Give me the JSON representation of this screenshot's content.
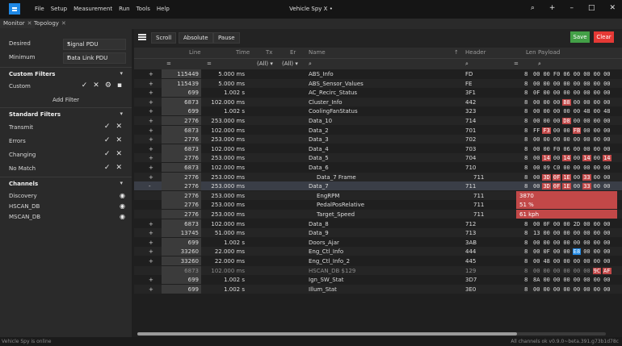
{
  "title": "Vehicle Spy X •",
  "menu": [
    "File",
    "Setup",
    "Measurement",
    "Run",
    "Tools",
    "Help"
  ],
  "window_controls": {
    "search": "⌕",
    "add": "+",
    "minimize": "–",
    "maximize": "□",
    "close": "✕"
  },
  "tabs": [
    {
      "label": "Monitor"
    },
    {
      "label": "Topology"
    }
  ],
  "left": {
    "desired_label": "Desired",
    "desired_value": "Signal PDU",
    "minimum_label": "Minimum",
    "minimum_value": "Data Link PDU",
    "custom_filters_title": "Custom Filters",
    "custom_item": "Custom",
    "add_filter": "Add Filter",
    "standard_filters_title": "Standard Filters",
    "standard_filters": [
      "Transmit",
      "Errors",
      "Changing",
      "No Match"
    ],
    "channels_title": "Channels",
    "channels": [
      "Discovery",
      "HSCAN_DB",
      "MSCAN_DB"
    ]
  },
  "toolbar": {
    "scroll": "Scroll",
    "absolute": "Absolute",
    "pause": "Pause",
    "save": "Save",
    "clear": "Clear"
  },
  "columns": {
    "line": "Line",
    "time": "Time",
    "tx": "Tx",
    "er": "Er",
    "name": "Name",
    "header": "Header",
    "len": "Len",
    "payload": "Payload"
  },
  "filters": {
    "eq": "=",
    "all1": "(All)",
    "all2": "(All)",
    "search": "⌕"
  },
  "rows": [
    {
      "plus": "+",
      "count": "115449",
      "time": "5.000 ms",
      "name": "ABS_Info",
      "header": "FD",
      "len": "8",
      "payload": [
        "00",
        "00",
        "F0",
        "06",
        "00",
        "00",
        "00",
        "00"
      ],
      "hl": []
    },
    {
      "plus": "+",
      "count": "115439",
      "time": "5.000 ms",
      "name": "ABS_Sensor_Values",
      "header": "FE",
      "len": "8",
      "payload": [
        "00",
        "00",
        "00",
        "00",
        "00",
        "00",
        "00",
        "00"
      ],
      "hl": []
    },
    {
      "plus": "+",
      "count": "699",
      "time": "1.002 s",
      "name": "AC_Recirc_Status",
      "header": "3F1",
      "len": "8",
      "payload": [
        "0F",
        "00",
        "00",
        "00",
        "00",
        "00",
        "00",
        "00"
      ],
      "hl": []
    },
    {
      "plus": "+",
      "count": "6873",
      "time": "102.000 ms",
      "name": "Cluster_Info",
      "header": "442",
      "len": "8",
      "payload": [
        "00",
        "00",
        "00",
        "B8",
        "00",
        "00",
        "00",
        "00"
      ],
      "hl": [
        3
      ]
    },
    {
      "plus": "+",
      "count": "699",
      "time": "1.002 s",
      "name": "CoolingFanStatus",
      "header": "323",
      "len": "8",
      "payload": [
        "00",
        "00",
        "00",
        "00",
        "00",
        "48",
        "00",
        "48"
      ],
      "hl": []
    },
    {
      "plus": "+",
      "count": "2776",
      "time": "253.000 ms",
      "name": "Data_10",
      "header": "714",
      "len": "8",
      "payload": [
        "00",
        "00",
        "00",
        "D8",
        "00",
        "00",
        "00",
        "00"
      ],
      "hl": [
        3
      ]
    },
    {
      "plus": "+",
      "count": "6873",
      "time": "102.000 ms",
      "name": "Data_2",
      "header": "701",
      "len": "8",
      "payload": [
        "FF",
        "F3",
        "00",
        "00",
        "FB",
        "00",
        "00",
        "00"
      ],
      "hl": [
        1,
        4
      ]
    },
    {
      "plus": "+",
      "count": "2776",
      "time": "253.000 ms",
      "name": "Data_3",
      "header": "702",
      "len": "8",
      "payload": [
        "00",
        "00",
        "00",
        "00",
        "00",
        "00",
        "00",
        "00"
      ],
      "hl": []
    },
    {
      "plus": "+",
      "count": "6873",
      "time": "102.000 ms",
      "name": "Data_4",
      "header": "703",
      "len": "8",
      "payload": [
        "00",
        "00",
        "F0",
        "06",
        "00",
        "00",
        "00",
        "00"
      ],
      "hl": []
    },
    {
      "plus": "+",
      "count": "2776",
      "time": "253.000 ms",
      "name": "Data_5",
      "header": "704",
      "len": "8",
      "payload": [
        "00",
        "14",
        "00",
        "14",
        "00",
        "14",
        "00",
        "14"
      ],
      "hl": [
        1,
        3,
        5,
        7
      ]
    },
    {
      "plus": "+",
      "count": "6873",
      "time": "102.000 ms",
      "name": "Data_6",
      "header": "710",
      "len": "8",
      "payload": [
        "00",
        "09",
        "C0",
        "00",
        "00",
        "00",
        "00",
        "00"
      ],
      "hl": []
    },
    {
      "plus": "+",
      "count": "2776",
      "time": "253.000 ms",
      "name": "Data_7 Frame",
      "header": "711",
      "len": "8",
      "payload": [
        "00",
        "3D",
        "0F",
        "1E",
        "00",
        "33",
        "00",
        "00"
      ],
      "hl": [
        1,
        2,
        3,
        5
      ],
      "indent": true
    },
    {
      "plus": "-",
      "count": "2776",
      "time": "253.000 ms",
      "name": "Data_7",
      "header": "711",
      "len": "8",
      "payload": [
        "00",
        "3D",
        "0F",
        "1E",
        "00",
        "33",
        "00",
        "00"
      ],
      "hl": [
        1,
        2,
        3,
        5
      ],
      "sel": true
    },
    {
      "plus": "",
      "count": "2776",
      "time": "253.000 ms",
      "name": "EngRPM",
      "header": "711",
      "len": "",
      "signal": "3870",
      "sig": true
    },
    {
      "plus": "",
      "count": "2776",
      "time": "253.000 ms",
      "name": "PedalPosRelative",
      "header": "711",
      "len": "",
      "signal": "51 %",
      "sig": true
    },
    {
      "plus": "",
      "count": "2776",
      "time": "253.000 ms",
      "name": "Target_Speed",
      "header": "711",
      "len": "",
      "signal": "61 kph",
      "sig": true
    },
    {
      "plus": "+",
      "count": "6873",
      "time": "102.000 ms",
      "name": "Data_8",
      "header": "712",
      "len": "8",
      "payload": [
        "00",
        "0F",
        "00",
        "00",
        "2D",
        "00",
        "00",
        "00"
      ],
      "hl": []
    },
    {
      "plus": "+",
      "count": "13745",
      "time": "51.000 ms",
      "name": "Data_9",
      "header": "713",
      "len": "8",
      "payload": [
        "13",
        "00",
        "00",
        "00",
        "00",
        "00",
        "00",
        "00"
      ],
      "hl": []
    },
    {
      "plus": "+",
      "count": "699",
      "time": "1.002 s",
      "name": "Doors_Ajar",
      "header": "3AB",
      "len": "8",
      "payload": [
        "00",
        "00",
        "00",
        "00",
        "00",
        "00",
        "00",
        "00"
      ],
      "hl": []
    },
    {
      "plus": "+",
      "count": "33260",
      "time": "22.000 ms",
      "name": "Eng_Ctl_Info",
      "header": "444",
      "len": "8",
      "payload": [
        "00",
        "0F",
        "00",
        "00",
        "E8",
        "00",
        "00",
        "00"
      ],
      "hl": [],
      "blue": [
        4
      ]
    },
    {
      "plus": "+",
      "count": "33260",
      "time": "22.000 ms",
      "name": "Eng_Ctl_Info_2",
      "header": "445",
      "len": "8",
      "payload": [
        "00",
        "48",
        "00",
        "00",
        "00",
        "00",
        "00",
        "00"
      ],
      "hl": []
    },
    {
      "plus": "",
      "count": "6873",
      "time": "102.000 ms",
      "name": "HSCAN_DB $129",
      "header": "129",
      "len": "8",
      "payload": [
        "00",
        "00",
        "00",
        "00",
        "00",
        "00",
        "9C",
        "AF"
      ],
      "hl": [
        6,
        7
      ],
      "dim": true
    },
    {
      "plus": "+",
      "count": "699",
      "time": "1.002 s",
      "name": "Ign_SW_Stat",
      "header": "3D7",
      "len": "8",
      "payload": [
        "8A",
        "00",
        "00",
        "00",
        "00",
        "00",
        "00",
        "00"
      ],
      "hl": []
    },
    {
      "plus": "+",
      "count": "699",
      "time": "1.002 s",
      "name": "Illum_Stat",
      "header": "3E0",
      "len": "8",
      "payload": [
        "00",
        "00",
        "00",
        "00",
        "00",
        "00",
        "00",
        "00"
      ],
      "hl": []
    }
  ],
  "status": {
    "left": "Vehicle Spy is online",
    "right": "All channels ok   v0.9.0~beta.391.g73b1d78c"
  }
}
